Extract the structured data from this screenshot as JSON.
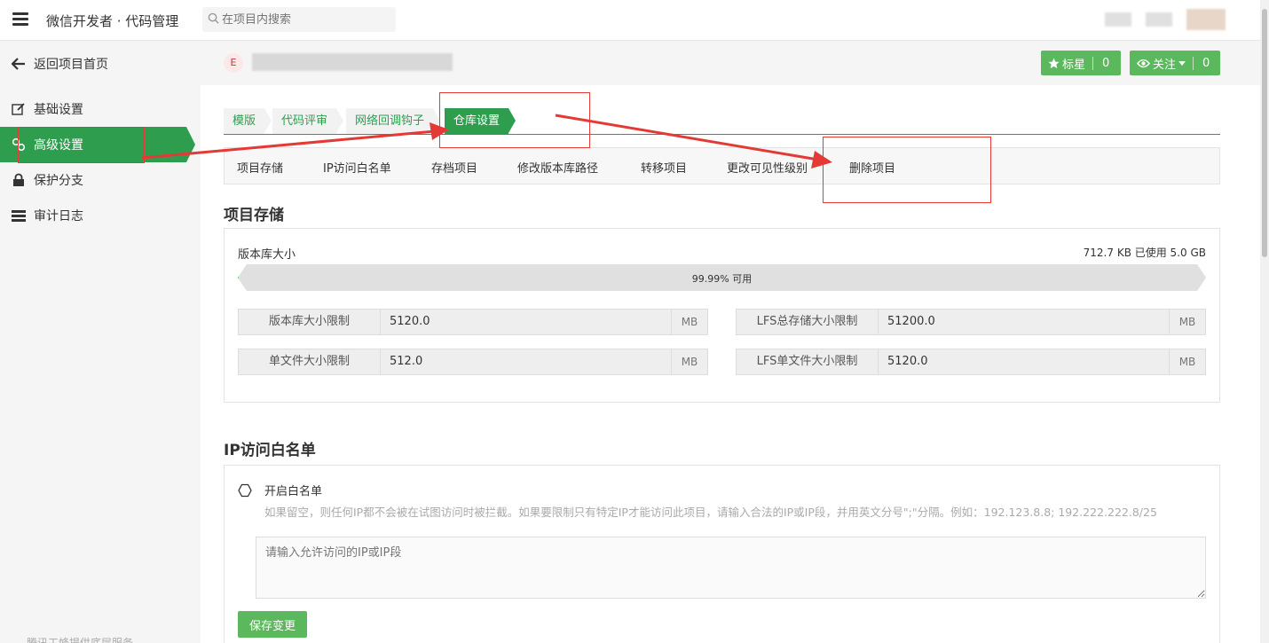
{
  "header": {
    "app_title": "微信开发者 · 代码管理",
    "search_placeholder": "在项目内搜索"
  },
  "sidebar": {
    "items": [
      {
        "label": "返回项目首页",
        "icon": "arrow-left-icon"
      },
      {
        "label": "基础设置",
        "icon": "edit-icon"
      },
      {
        "label": "高级设置",
        "icon": "link-icon"
      },
      {
        "label": "保护分支",
        "icon": "lock-icon"
      },
      {
        "label": "审计日志",
        "icon": "list-icon"
      }
    ],
    "footer": "腾讯工蜂提供底层服务"
  },
  "project": {
    "badge": "E",
    "star_label": "标星",
    "star_count": "0",
    "watch_label": "关注",
    "watch_count": "0"
  },
  "tabs": [
    {
      "label": "模版"
    },
    {
      "label": "代码评审"
    },
    {
      "label": "网络回调钩子"
    },
    {
      "label": "仓库设置",
      "active": true
    }
  ],
  "subnav": [
    {
      "label": "项目存储"
    },
    {
      "label": "IP访问白名单"
    },
    {
      "label": "存档项目"
    },
    {
      "label": "修改版本库路径"
    },
    {
      "label": "转移项目"
    },
    {
      "label": "更改可见性级别"
    },
    {
      "label": "删除项目"
    }
  ],
  "storage": {
    "title": "项目存储",
    "repo_size_label": "版本库大小",
    "usage_text": "712.7 KB 已使用 5.0 GB",
    "progress_text": "99.99% 可用",
    "used_fraction": 0.0001,
    "fields": [
      {
        "label": "版本库大小限制",
        "value": "5120.0",
        "unit": "MB"
      },
      {
        "label": "LFS总存储大小限制",
        "value": "51200.0",
        "unit": "MB"
      },
      {
        "label": "单文件大小限制",
        "value": "512.0",
        "unit": "MB"
      },
      {
        "label": "LFS单文件大小限制",
        "value": "5120.0",
        "unit": "MB"
      }
    ]
  },
  "ip_whitelist": {
    "title": "IP访问白名单",
    "toggle_label": "开启白名单",
    "hint": "如果留空，则任何IP都不会被在试图访问时被拦截。如果要限制只有特定IP才能访问此项目，请输入合法的IP或IP段，并用英文分号\";\"分隔。例如：192.123.8.8; 192.222.222.8/25",
    "textarea_placeholder": "请输入允许访问的IP或IP段",
    "save_label": "保存变更"
  },
  "colors": {
    "brand_green": "#2e9e4e",
    "button_green": "#5cb85c",
    "annotation_red": "#e53935"
  }
}
